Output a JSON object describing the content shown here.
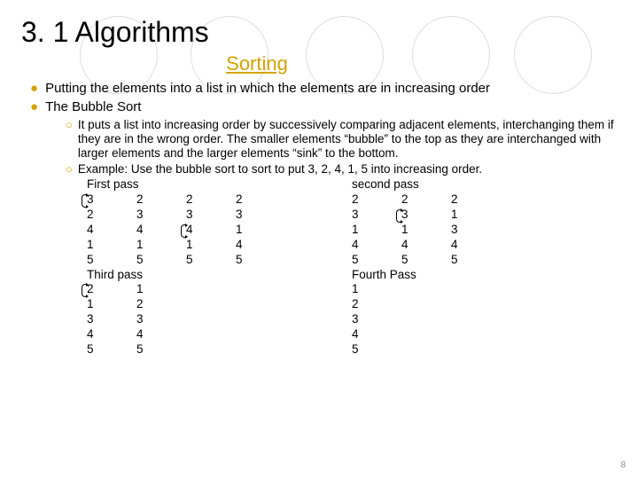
{
  "title": "3. 1 Algorithms",
  "subtitle": "Sorting",
  "bullets": {
    "b1": "Putting the elements into a list in which the elements are in increasing order",
    "b2": "The Bubble Sort",
    "s1": "It puts a list into increasing order by successively comparing adjacent elements, interchanging them if they are in the wrong order. The smaller elements “bubble” to the top as they are interchanged with larger elements and the larger elements “sink” to the bottom.",
    "s2": "Example: Use the bubble sort to sort to put 3, 2, 4, 1, 5 into increasing order."
  },
  "passes": {
    "first": {
      "label": "First pass",
      "c1": [
        "3",
        "2",
        "4",
        "1",
        "5"
      ],
      "c2": [
        "2",
        "3",
        "4",
        "1",
        "5"
      ],
      "c3": [
        "2",
        "3",
        "4",
        "1",
        "5"
      ],
      "c4": [
        "2",
        "3",
        "1",
        "4",
        "5"
      ]
    },
    "second": {
      "label": "second pass",
      "c1": [
        "2",
        "3",
        "1",
        "4",
        "5"
      ],
      "c2": [
        "2",
        "3",
        "1",
        "4",
        "5"
      ],
      "c3": [
        "2",
        "1",
        "3",
        "4",
        "5"
      ]
    },
    "third": {
      "label": "Third pass",
      "c1": [
        "2",
        "1",
        "3",
        "4",
        "5"
      ],
      "c2": [
        "1",
        "2",
        "3",
        "4",
        "5"
      ]
    },
    "fourth": {
      "label": "Fourth Pass",
      "c1": [
        "1",
        "2",
        "3",
        "4",
        "5"
      ]
    }
  },
  "page_number": "8"
}
